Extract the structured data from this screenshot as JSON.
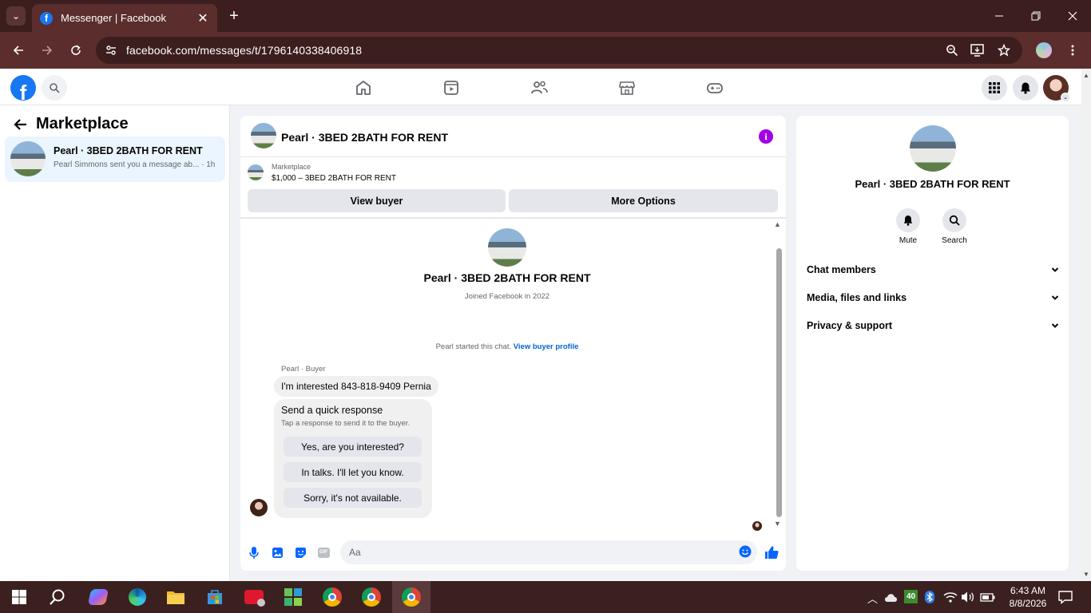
{
  "browser": {
    "tab_title": "Messenger | Facebook",
    "url": "facebook.com/messages/t/1796140338406918",
    "new_tab": "+",
    "tab_close": "✕"
  },
  "sidebar": {
    "title": "Marketplace",
    "conversation": {
      "name": "Pearl · 3BED 2BATH FOR RENT",
      "preview": "Pearl Simmons sent you a message ab... · 1h"
    }
  },
  "chat": {
    "title": "Pearl · 3BED 2BATH FOR RENT",
    "listing": {
      "tag": "Marketplace",
      "price": "$1,000 – 3BED 2BATH FOR RENT"
    },
    "buttons": {
      "view_buyer": "View buyer",
      "more_options": "More Options"
    },
    "intro": {
      "name": "Pearl · 3BED 2BATH FOR RENT",
      "joined": "Joined Facebook in 2022"
    },
    "started": {
      "text": "Pearl started this chat. ",
      "link": "View buyer profile"
    },
    "sender_label": "Pearl · Buyer",
    "message": "I'm interested 843-818-9409 Pernia",
    "quick_response": {
      "title": "Send a quick response",
      "subtitle": "Tap a response to send it to the buyer.",
      "options": [
        "Yes, are you interested?",
        "In talks. I'll let you know.",
        "Sorry, it's not available."
      ]
    },
    "composer": {
      "placeholder": "Aa",
      "gif_label": "GIF"
    }
  },
  "info_panel": {
    "name": "Pearl · 3BED 2BATH FOR RENT",
    "actions": {
      "mute": "Mute",
      "search": "Search"
    },
    "sections": [
      "Chat members",
      "Media, files and links",
      "Privacy & support"
    ]
  },
  "taskbar": {
    "time": "6:43 AM",
    "date": "8/8/2026",
    "badge": "40"
  },
  "colors": {
    "brand_blue": "#1877f2",
    "info_purple": "#a200e5",
    "link_blue": "#0064d1",
    "chrome_bg": "#5b2d2d"
  }
}
